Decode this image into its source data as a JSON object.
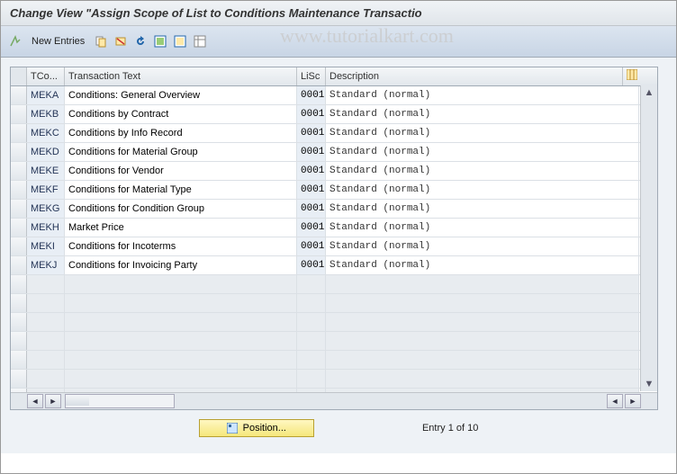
{
  "title": "Change View \"Assign Scope of List to Conditions Maintenance Transactio",
  "watermark": "www.tutorialkart.com",
  "toolbar": {
    "new_entries": "New Entries"
  },
  "table": {
    "headers": {
      "tco": "TCo...",
      "text": "Transaction Text",
      "lisc": "LiSc",
      "desc": "Description"
    },
    "rows": [
      {
        "tco": "MEKA",
        "text": "Conditions: General Overview",
        "lisc": "0001",
        "desc": "Standard (normal)"
      },
      {
        "tco": "MEKB",
        "text": "Conditions by Contract",
        "lisc": "0001",
        "desc": "Standard (normal)"
      },
      {
        "tco": "MEKC",
        "text": "Conditions by Info Record",
        "lisc": "0001",
        "desc": "Standard (normal)"
      },
      {
        "tco": "MEKD",
        "text": "Conditions for Material Group",
        "lisc": "0001",
        "desc": "Standard (normal)"
      },
      {
        "tco": "MEKE",
        "text": "Conditions for Vendor",
        "lisc": "0001",
        "desc": "Standard (normal)"
      },
      {
        "tco": "MEKF",
        "text": "Conditions for Material Type",
        "lisc": "0001",
        "desc": "Standard (normal)"
      },
      {
        "tco": "MEKG",
        "text": "Conditions for Condition Group",
        "lisc": "0001",
        "desc": "Standard (normal)"
      },
      {
        "tco": "MEKH",
        "text": "Market Price",
        "lisc": "0001",
        "desc": "Standard (normal)"
      },
      {
        "tco": "MEKI",
        "text": "Conditions for Incoterms",
        "lisc": "0001",
        "desc": "Standard (normal)"
      },
      {
        "tco": "MEKJ",
        "text": "Conditions for Invoicing Party",
        "lisc": "0001",
        "desc": "Standard (normal)"
      }
    ],
    "empty_rows": 7
  },
  "footer": {
    "position_label": "Position...",
    "entry_text": "Entry 1 of 10"
  }
}
